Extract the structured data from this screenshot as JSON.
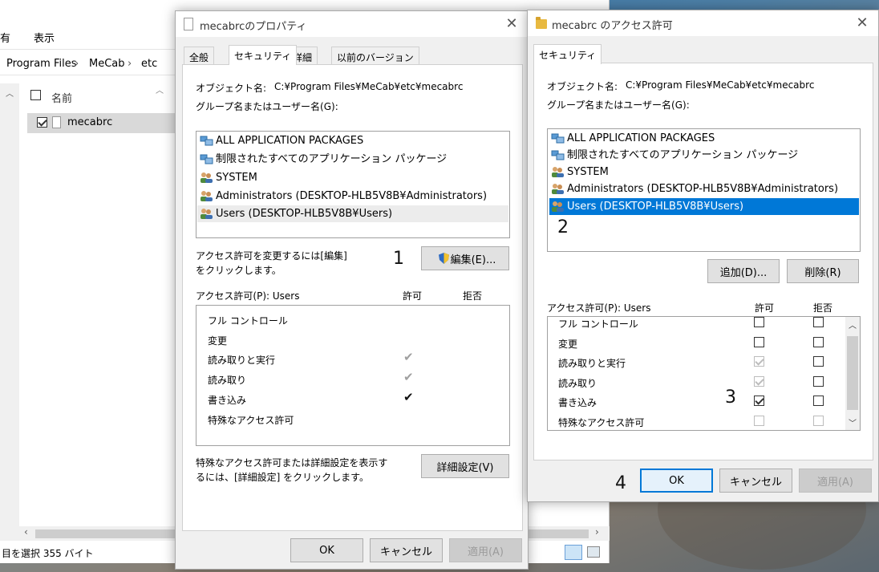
{
  "explorer": {
    "ribbon_items": [
      "有",
      "表示"
    ],
    "path": [
      "Program Files",
      "MeCab",
      "etc"
    ],
    "column_name": "名前",
    "file_name": "mecabrc",
    "status": "目を選択  355 バイト"
  },
  "props_dialog": {
    "title": "mecabrcのプロパティ",
    "tabs": [
      "全般",
      "セキュリティ",
      "詳細",
      "以前のバージョン"
    ],
    "object_label": "オブジェクト名:",
    "object_value": "C:¥Program Files¥MeCab¥etc¥mecabrc",
    "group_label": "グループ名またはユーザー名(G):",
    "principals": [
      "ALL APPLICATION PACKAGES",
      "制限されたすべてのアプリケーション パッケージ",
      "SYSTEM",
      "Administrators (DESKTOP-HLB5V8B¥Administrators)",
      "Users (DESKTOP-HLB5V8B¥Users)"
    ],
    "edit_hint_line1": "アクセス許可を変更するには[編集]",
    "edit_hint_line2": "をクリックします。",
    "edit_button": "編集(E)...",
    "perm_label": "アクセス許可(P): Users",
    "allow_header": "許可",
    "deny_header": "拒否",
    "permissions": [
      {
        "name": "フル コントロール",
        "allow": "none"
      },
      {
        "name": "変更",
        "allow": "none"
      },
      {
        "name": "読み取りと実行",
        "allow": "inherited"
      },
      {
        "name": "読み取り",
        "allow": "inherited"
      },
      {
        "name": "書き込み",
        "allow": "explicit"
      },
      {
        "name": "特殊なアクセス許可",
        "allow": "none"
      }
    ],
    "advanced_hint_line1": "特殊なアクセス許可または詳細設定を表示す",
    "advanced_hint_line2": "るには、[詳細設定] をクリックします。",
    "advanced_button": "詳細設定(V)",
    "ok": "OK",
    "cancel": "キャンセル",
    "apply": "適用(A)"
  },
  "access_dialog": {
    "title": "mecabrc のアクセス許可",
    "tab": "セキュリティ",
    "object_label": "オブジェクト名:",
    "object_value": "C:¥Program Files¥MeCab¥etc¥mecabrc",
    "group_label": "グループ名またはユーザー名(G):",
    "principals": [
      "ALL APPLICATION PACKAGES",
      "制限されたすべてのアプリケーション パッケージ",
      "SYSTEM",
      "Administrators (DESKTOP-HLB5V8B¥Administrators)",
      "Users (DESKTOP-HLB5V8B¥Users)"
    ],
    "add_button": "追加(D)...",
    "remove_button": "削除(R)",
    "perm_label": "アクセス許可(P): Users",
    "allow_header": "許可",
    "deny_header": "拒否",
    "permissions": [
      {
        "name": "フル コントロール",
        "allow": false,
        "allow_disabled": false,
        "deny": false,
        "deny_disabled": false
      },
      {
        "name": "変更",
        "allow": false,
        "allow_disabled": false,
        "deny": false,
        "deny_disabled": false
      },
      {
        "name": "読み取りと実行",
        "allow": true,
        "allow_disabled": true,
        "deny": false,
        "deny_disabled": false
      },
      {
        "name": "読み取り",
        "allow": true,
        "allow_disabled": true,
        "deny": false,
        "deny_disabled": false
      },
      {
        "name": "書き込み",
        "allow": true,
        "allow_disabled": false,
        "deny": false,
        "deny_disabled": false
      },
      {
        "name": "特殊なアクセス許可",
        "allow": false,
        "allow_disabled": true,
        "deny": false,
        "deny_disabled": true
      }
    ],
    "ok": "OK",
    "cancel": "キャンセル",
    "apply": "適用(A)"
  },
  "annotations": [
    "1",
    "2",
    "3",
    "4"
  ],
  "colors": {
    "selection": "#0078d7",
    "dialog_bg": "#f0f0f0",
    "button_bg": "#e1e1e1"
  }
}
